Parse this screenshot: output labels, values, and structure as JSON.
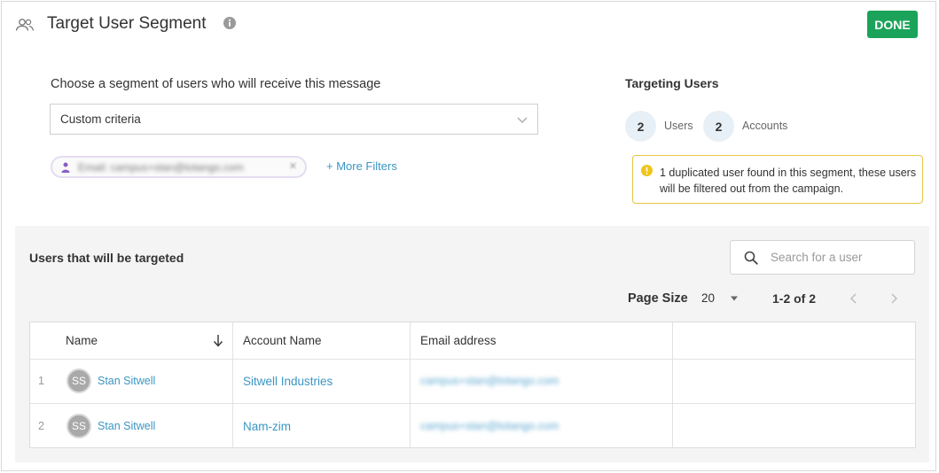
{
  "header": {
    "title": "Target User Segment",
    "done_label": "DONE",
    "icons": {
      "segment": "users-icon",
      "info": "info-icon"
    }
  },
  "segment": {
    "prompt": "Choose a segment of users who will receive this message",
    "selected": "Custom criteria",
    "filter_chip": "Email: campus+stan@totango.com",
    "more_filters": "+ More Filters"
  },
  "targeting": {
    "title": "Targeting Users",
    "users_count": "2",
    "users_label": "Users",
    "accounts_count": "2",
    "accounts_label": "Accounts",
    "warning": "1 duplicated user found in this segment, these users will be filtered out from the campaign."
  },
  "table": {
    "title": "Users that will be targeted",
    "search_placeholder": "Search for a user",
    "page_size_label": "Page Size",
    "page_size": "20",
    "range": "1-2 of 2",
    "columns": {
      "name": "Name",
      "account": "Account Name",
      "email": "Email address"
    },
    "rows": [
      {
        "index": "1",
        "initials": "SS",
        "name": "Stan Sitwell",
        "account": "Sitwell Industries",
        "email": "campus+stan@totango.com"
      },
      {
        "index": "2",
        "initials": "SS",
        "name": "Stan Sitwell",
        "account": "Nam-zim",
        "email": "campus+stan@totango.com"
      }
    ]
  },
  "colors": {
    "accent": "#1ba35a",
    "link": "#3b96c4",
    "warning": "#e8c547",
    "panel": "#f4f4f4"
  }
}
